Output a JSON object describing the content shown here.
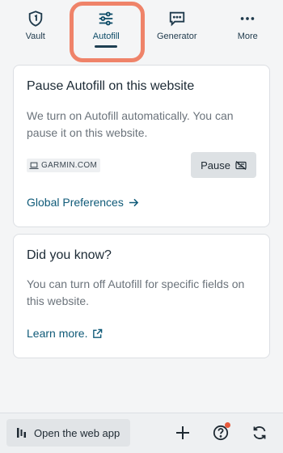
{
  "nav": {
    "tabs": [
      {
        "label": "Vault",
        "icon": "vault-shield-icon",
        "active": false
      },
      {
        "label": "Autofill",
        "icon": "sliders-icon",
        "active": true
      },
      {
        "label": "Generator",
        "icon": "generator-chat-icon",
        "active": false
      },
      {
        "label": "More",
        "icon": "more-dots-icon",
        "active": false
      }
    ]
  },
  "pause_card": {
    "title": "Pause Autofill on this website",
    "body": "We turn on Autofill automatically. You can pause it on this website.",
    "site": "GARMIN.COM",
    "pause_label": "Pause",
    "link_label": "Global Preferences"
  },
  "tip_card": {
    "title": "Did you know?",
    "body": "You can turn off Autofill for specific fields on this website.",
    "link_label": "Learn more."
  },
  "bottom_bar": {
    "webapp_label": "Open the web app"
  },
  "colors": {
    "highlight_ring": "#ef8369",
    "link": "#0f5a78",
    "notification_dot": "#e8593b"
  }
}
